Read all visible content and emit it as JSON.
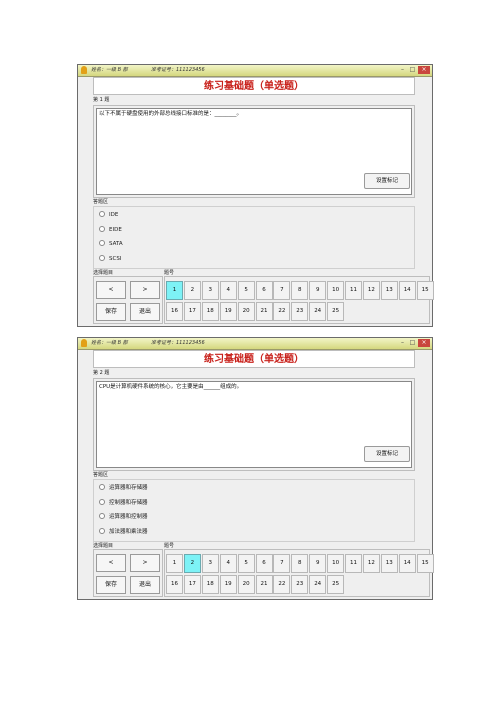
{
  "windows": [
    {
      "titlebar": {
        "name": "姓名：一级 B 部",
        "exam_id": "准考证号：111123456"
      },
      "title": "练习基础题（单选题）",
      "question_label": "第 1 题",
      "question_text": "以下不属于硬盘使用的外部总线接口标准的是：________。",
      "mark_button": "设置标记",
      "answer_label": "答题区",
      "options": [
        "IDE",
        "EIDE",
        "SATA",
        "SCSI"
      ],
      "nav_label": "选择题目",
      "prev": "<",
      "next": ">",
      "save": "保存",
      "exit": "退出",
      "qnum_label": "题号",
      "row1": [
        "1",
        "2",
        "3",
        "4",
        "5",
        "6",
        "7",
        "8",
        "9",
        "10",
        "11",
        "12",
        "13",
        "14",
        "15"
      ],
      "row2": [
        "16",
        "17",
        "18",
        "19",
        "20",
        "21",
        "22",
        "23",
        "24",
        "25"
      ],
      "active_question": "1"
    },
    {
      "titlebar": {
        "name": "姓名：一级 B 部",
        "exam_id": "准考证号：111123456"
      },
      "title": "练习基础题（单选题）",
      "question_label": "第 2 题",
      "question_text": "CPU是计算机硬件系统的核心，它主要是由______组成的。",
      "mark_button": "设置标记",
      "answer_label": "答题区",
      "options": [
        "运算器和存储器",
        "控制器和存储器",
        "运算器和控制器",
        "加法器和乘法器"
      ],
      "nav_label": "选择题目",
      "prev": "<",
      "next": ">",
      "save": "保存",
      "exit": "退出",
      "qnum_label": "题号",
      "row1": [
        "1",
        "2",
        "3",
        "4",
        "5",
        "6",
        "7",
        "8",
        "9",
        "10",
        "11",
        "12",
        "13",
        "14",
        "15"
      ],
      "row2": [
        "16",
        "17",
        "18",
        "19",
        "20",
        "21",
        "22",
        "23",
        "24",
        "25"
      ],
      "active_question": "2"
    }
  ],
  "colors": {
    "title_red": "#c8201a",
    "active_cell": "#7df2f6"
  }
}
